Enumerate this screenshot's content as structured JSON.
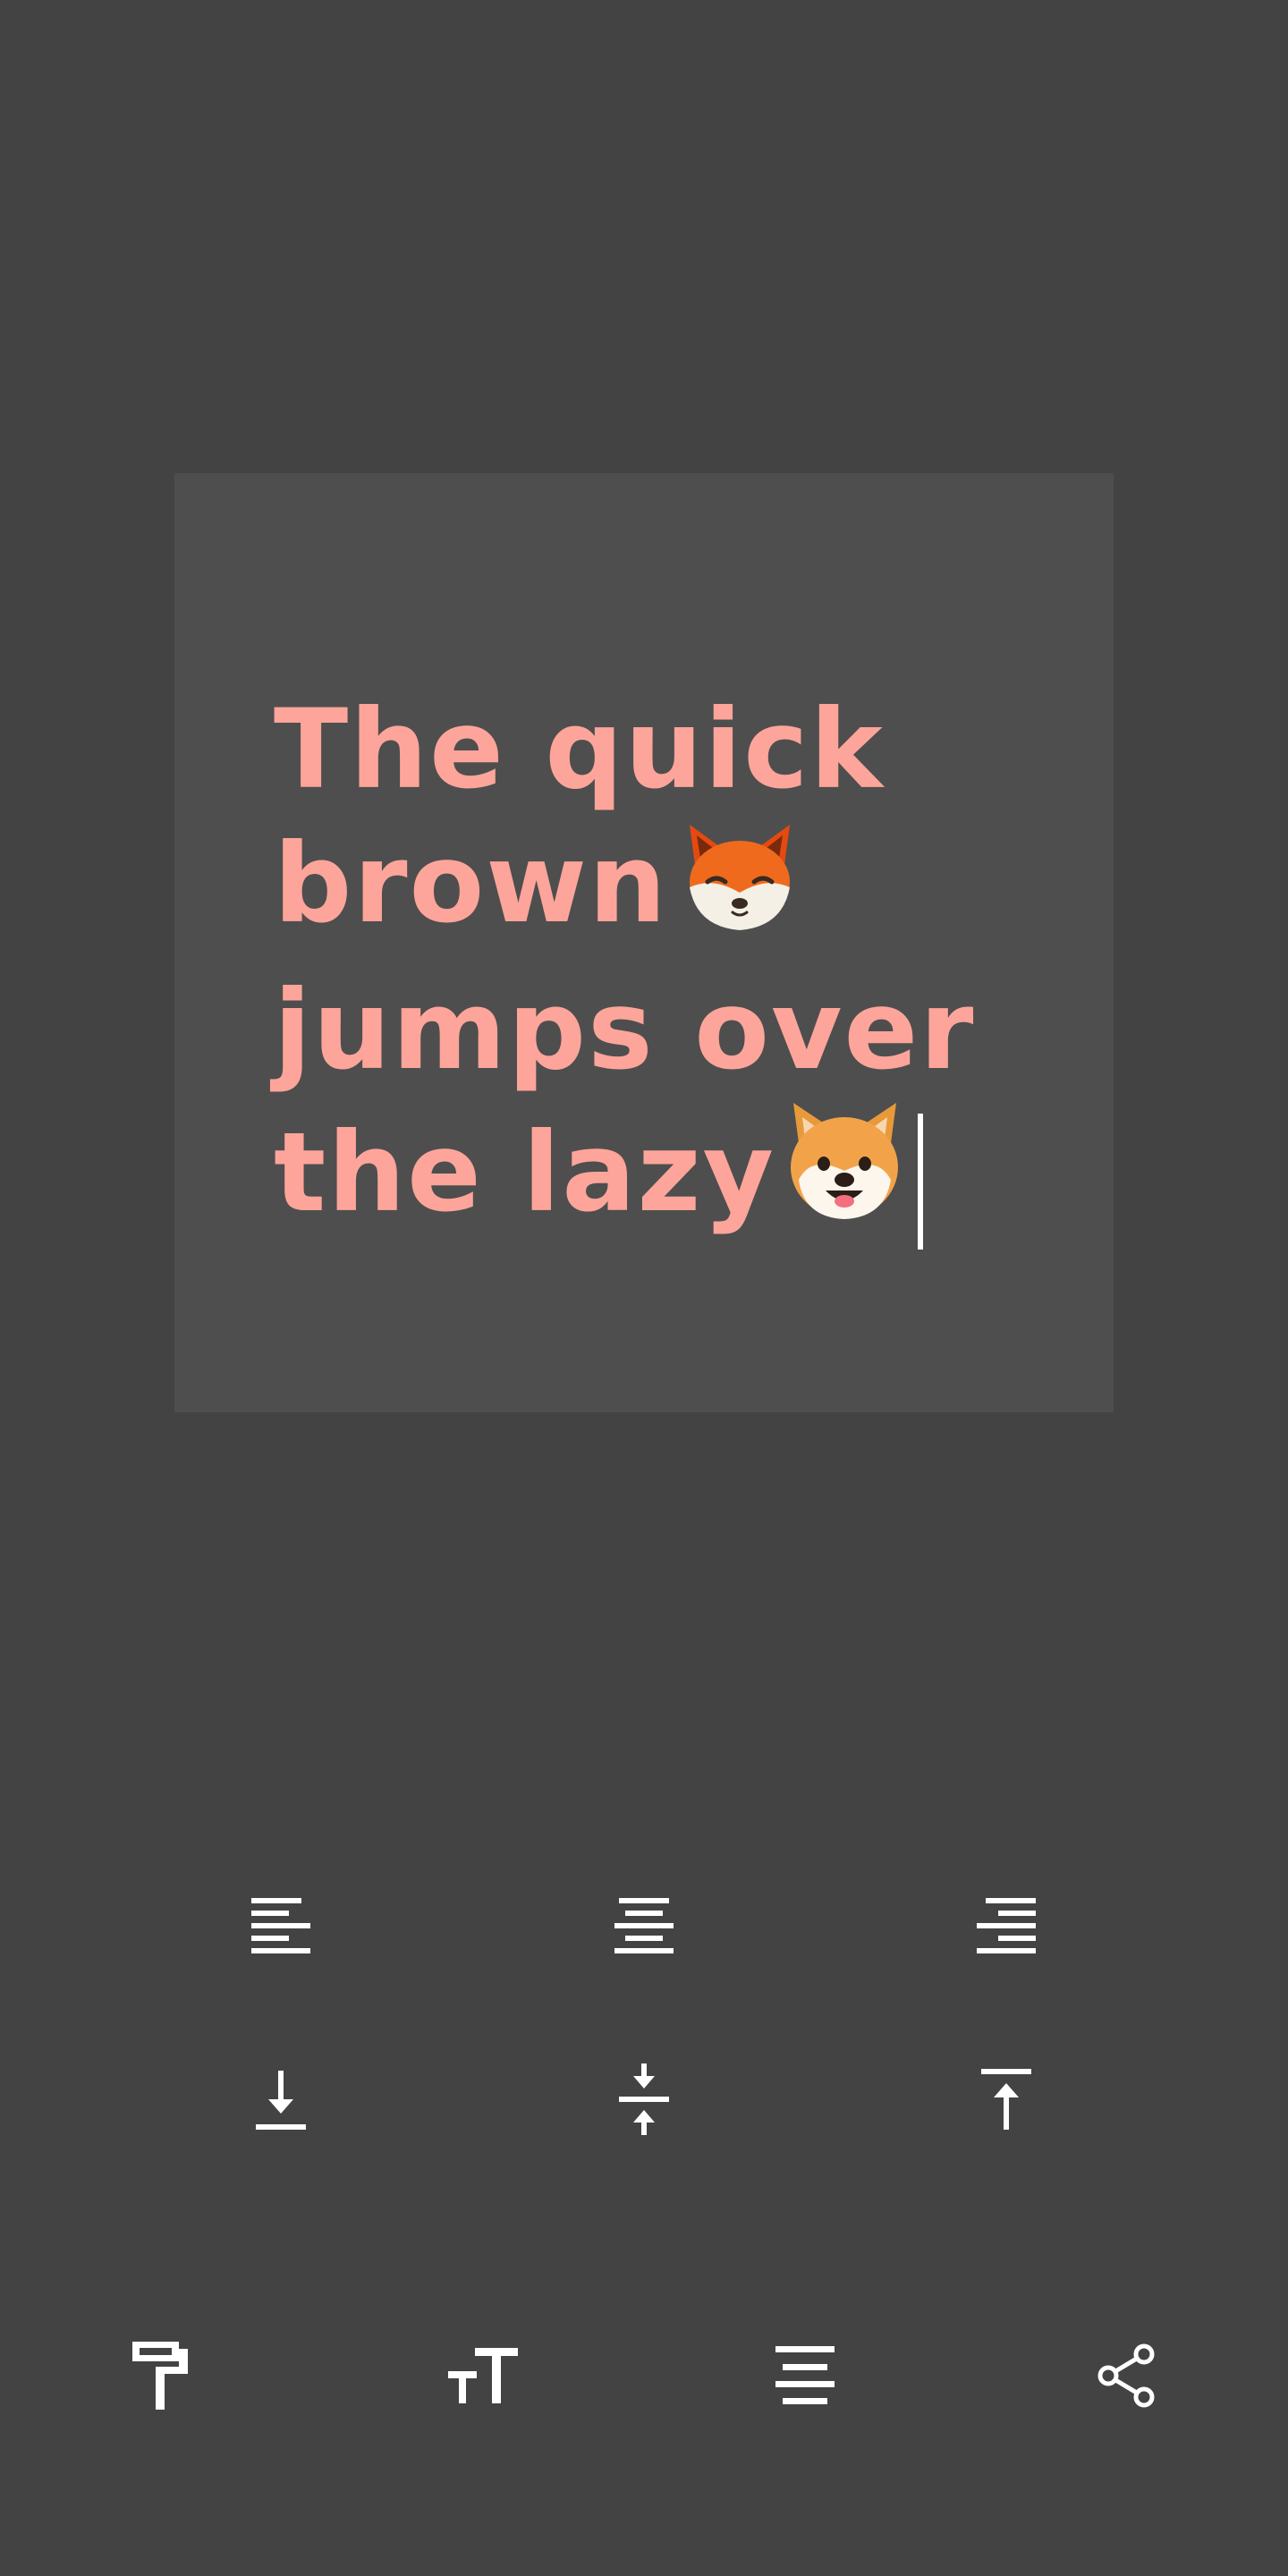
{
  "editor": {
    "lines": [
      "The quick",
      "brown",
      "jumps over",
      "the lazy"
    ],
    "emoji": {
      "fox": "fox-face",
      "dog": "shiba-dog-face"
    },
    "text_color": "#fda59a",
    "canvas_color": "#4e4e4e",
    "background_color": "#434343"
  },
  "toolbar": {
    "horizontal_alignment": [
      "align-left-icon",
      "align-center-icon",
      "align-right-icon"
    ],
    "vertical_alignment": [
      "align-bottom-icon",
      "align-middle-icon",
      "align-top-icon"
    ],
    "bottom_bar": [
      "paint-roller-icon",
      "text-size-icon",
      "text-align-icon",
      "share-icon"
    ]
  }
}
